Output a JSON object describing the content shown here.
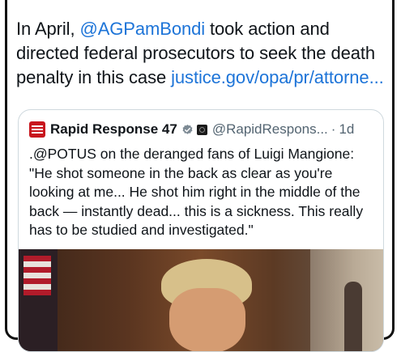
{
  "post": {
    "text_before_mention": "In April, ",
    "mention": "@AGPamBondi",
    "text_after_mention": " took action and directed federal prosecutors to seek the death penalty in this case ",
    "link": "justice.gov/opa/pr/attorne..."
  },
  "quoted_post": {
    "display_name": "Rapid Response 47",
    "handle": "@RapidRespons...",
    "separator": "·",
    "time": "1d",
    "text": ".@POTUS on the deranged fans of Luigi Mangione: \"He shot someone in the back as clear as you're looking at me... He shot him right in the middle of the back — instantly dead... this is a sickness. This really has to be studied and investigated.\""
  },
  "colors": {
    "link": "#1d74d8",
    "text": "#0f1419",
    "secondary_text": "#536471",
    "verified_badge": "#1d9bf0",
    "avatar": "#c8161d"
  },
  "icons": {
    "verified": "verified-badge-icon",
    "government_affiliation": "government-badge-icon"
  }
}
